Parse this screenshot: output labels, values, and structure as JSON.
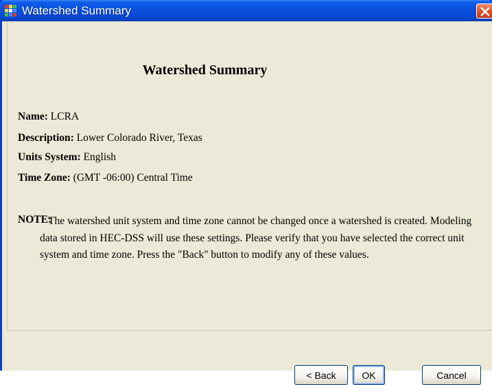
{
  "window": {
    "title": "Watershed Summary"
  },
  "summary": {
    "heading": "Watershed Summary",
    "name_label": "Name:",
    "name_value": " LCRA",
    "description_label": "Description:",
    "description_value": " Lower Colorado River, Texas",
    "units_label": "Units System:",
    "units_value": " English",
    "timezone_label": "Time Zone:",
    "timezone_value": " (GMT -06:00) Central Time"
  },
  "note": {
    "label": "NOTE:",
    "text": "The watershed unit system and time zone cannot be changed once a watershed is created. Modeling data stored in HEC-DSS will use these settings. Please verify that you have selected the correct unit system and time zone. Press the \"Back\" button to modify any of these values."
  },
  "buttons": {
    "back": "< Back",
    "ok": "OK",
    "cancel": "Cancel"
  },
  "icons": {
    "app": "hec-hms-grid-icon",
    "close": "close-icon"
  }
}
